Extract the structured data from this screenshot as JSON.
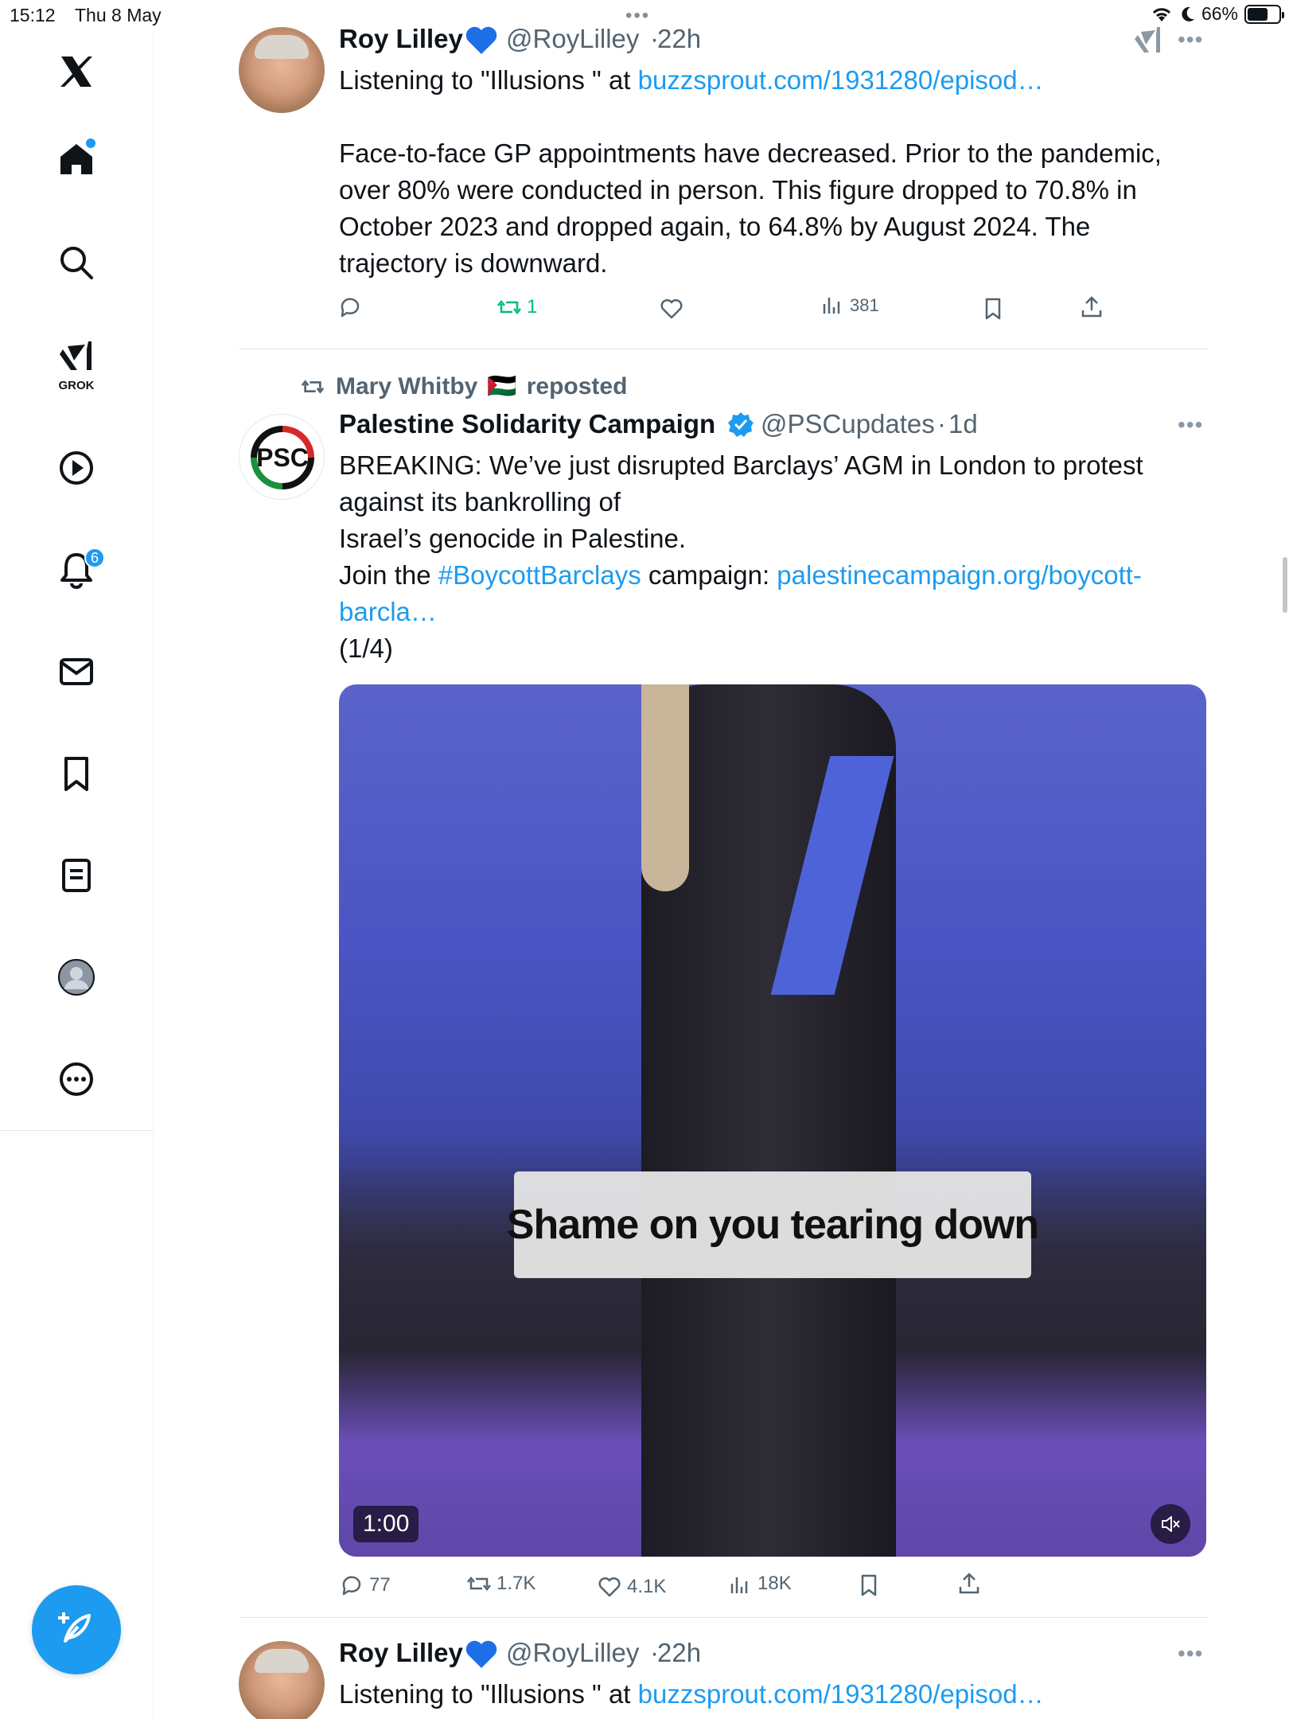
{
  "status_bar": {
    "time": "15:12",
    "date": "Thu 8 May",
    "battery": "66%",
    "battery_level": 0.66
  },
  "sidebar": {
    "grok_label": "GROK",
    "notifications_badge": "6",
    "icons": [
      "x-logo-icon",
      "home-icon",
      "search-icon",
      "grok-icon",
      "video-icon",
      "bell-icon",
      "mail-icon",
      "bookmark-icon",
      "lists-icon",
      "profile-icon",
      "more-icon",
      "compose-icon"
    ]
  },
  "tweets": [
    {
      "name": "Roy Lilley",
      "handle": "@RoyLilley",
      "time": "22h",
      "line1_prefix": "Listening to \"Illusions \" at ",
      "line1_link": "buzzsprout.com/1931280/episod…",
      "body_lines": [
        "Face-to-face GP appointments have decreased. Prior to the pandemic,",
        "over 80% were conducted in person. This figure dropped to 70.8% in",
        "October 2023 and dropped again, to 64.8% by August 2024. The",
        "trajectory is downward."
      ],
      "retweets": "1",
      "views": "381"
    },
    {
      "reposted_by": "Mary Whitby",
      "reposted_flag": "🇵🇸",
      "reposted_label": "reposted",
      "name": "Palestine Solidarity Campaign",
      "handle": "@PSCupdates",
      "time": "1d",
      "avatar_text": "PSC",
      "line1": "BREAKING: We’ve just disrupted Barclays’ AGM in London to protest",
      "line2": "against its bankrolling of",
      "line3": "Israel’s genocide in Palestine.",
      "line4_prefix": "Join the ",
      "line4_hashtag": "#BoycottBarclays",
      "line4_mid": " campaign: ",
      "line4_link": "palestinecampaign.org/boycott-",
      "line5_link": "barcla…",
      "line6": "(1/4)",
      "video_caption": "Shame on you tearing down",
      "video_duration": "1:00",
      "replies": "77",
      "retweets": "1.7K",
      "likes": "4.1K",
      "views": "18K"
    },
    {
      "name": "Roy Lilley",
      "handle": "@RoyLilley",
      "time": "22h",
      "line1_prefix": "Listening to \"Illusions \" at ",
      "line1_link": "buzzsprout.com/1931280/episod…"
    }
  ],
  "colors": {
    "accent": "#1d9bf0",
    "retweet_green": "#00ba7c",
    "text": "#0f1419",
    "muted": "#536471"
  }
}
